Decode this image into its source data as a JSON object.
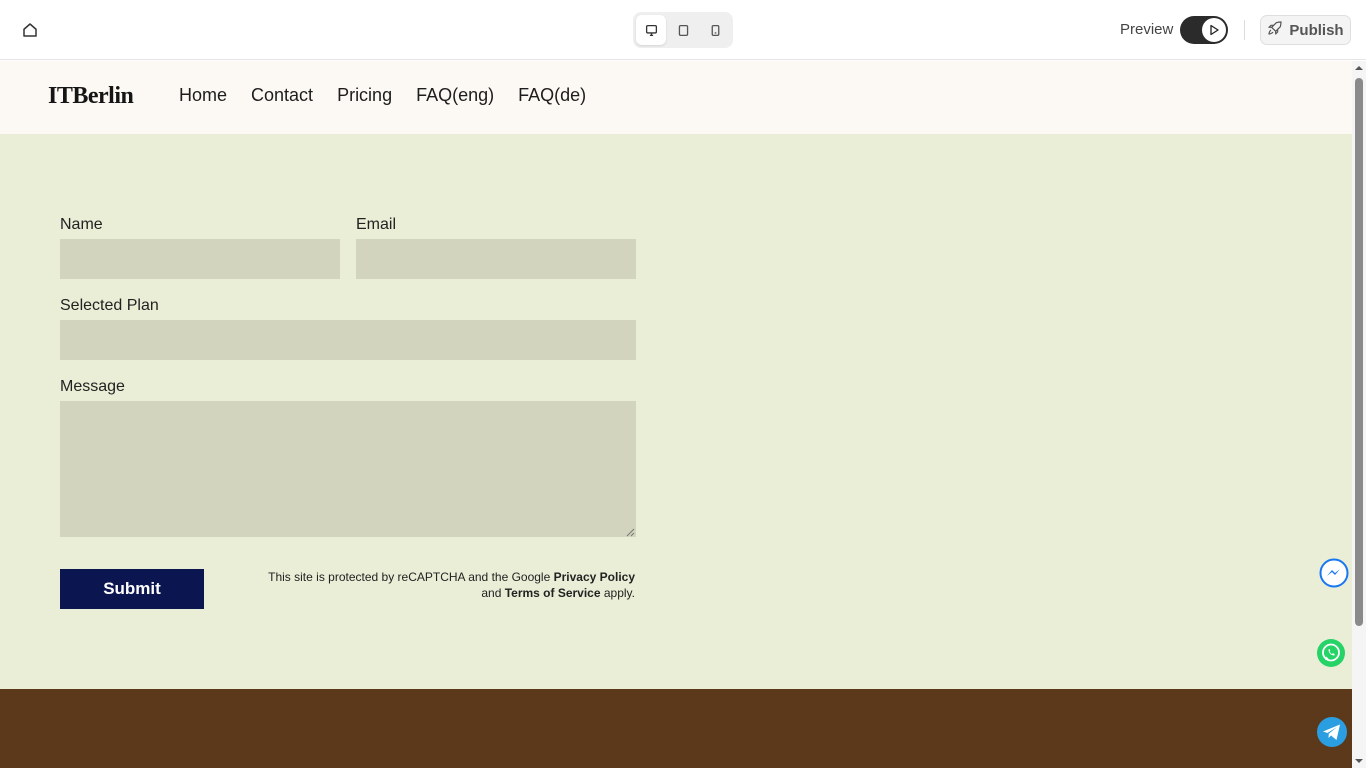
{
  "editor": {
    "preview_label": "Preview",
    "publish_label": "Publish",
    "icons": [
      "home-icon",
      "desktop-icon",
      "tablet-icon",
      "mobile-icon",
      "play-icon",
      "rocket-icon"
    ]
  },
  "site": {
    "logo": "ITBerlin",
    "nav": [
      "Home",
      "Contact",
      "Pricing",
      "FAQ(eng)",
      "FAQ(de)"
    ],
    "form": {
      "name_label": "Name",
      "name_value": "",
      "email_label": "Email",
      "email_value": "",
      "plan_label": "Selected Plan",
      "plan_value": "",
      "message_label": "Message",
      "message_value": "",
      "submit_label": "Submit",
      "recaptcha_prefix": "This site is protected by reCAPTCHA and the Google ",
      "privacy_link": "Privacy Policy",
      "recaptcha_and": " and ",
      "terms_link": "Terms of Service",
      "recaptcha_suffix": " apply."
    }
  },
  "colors": {
    "header_bg": "#fcf9f4",
    "form_bg": "#eaeed6",
    "field_bg": "#d3d4bd",
    "submit_bg": "#0b1650",
    "footer_bg": "#5c391b"
  },
  "widgets": [
    "messenger-icon",
    "whatsapp-icon",
    "telegram-icon"
  ]
}
